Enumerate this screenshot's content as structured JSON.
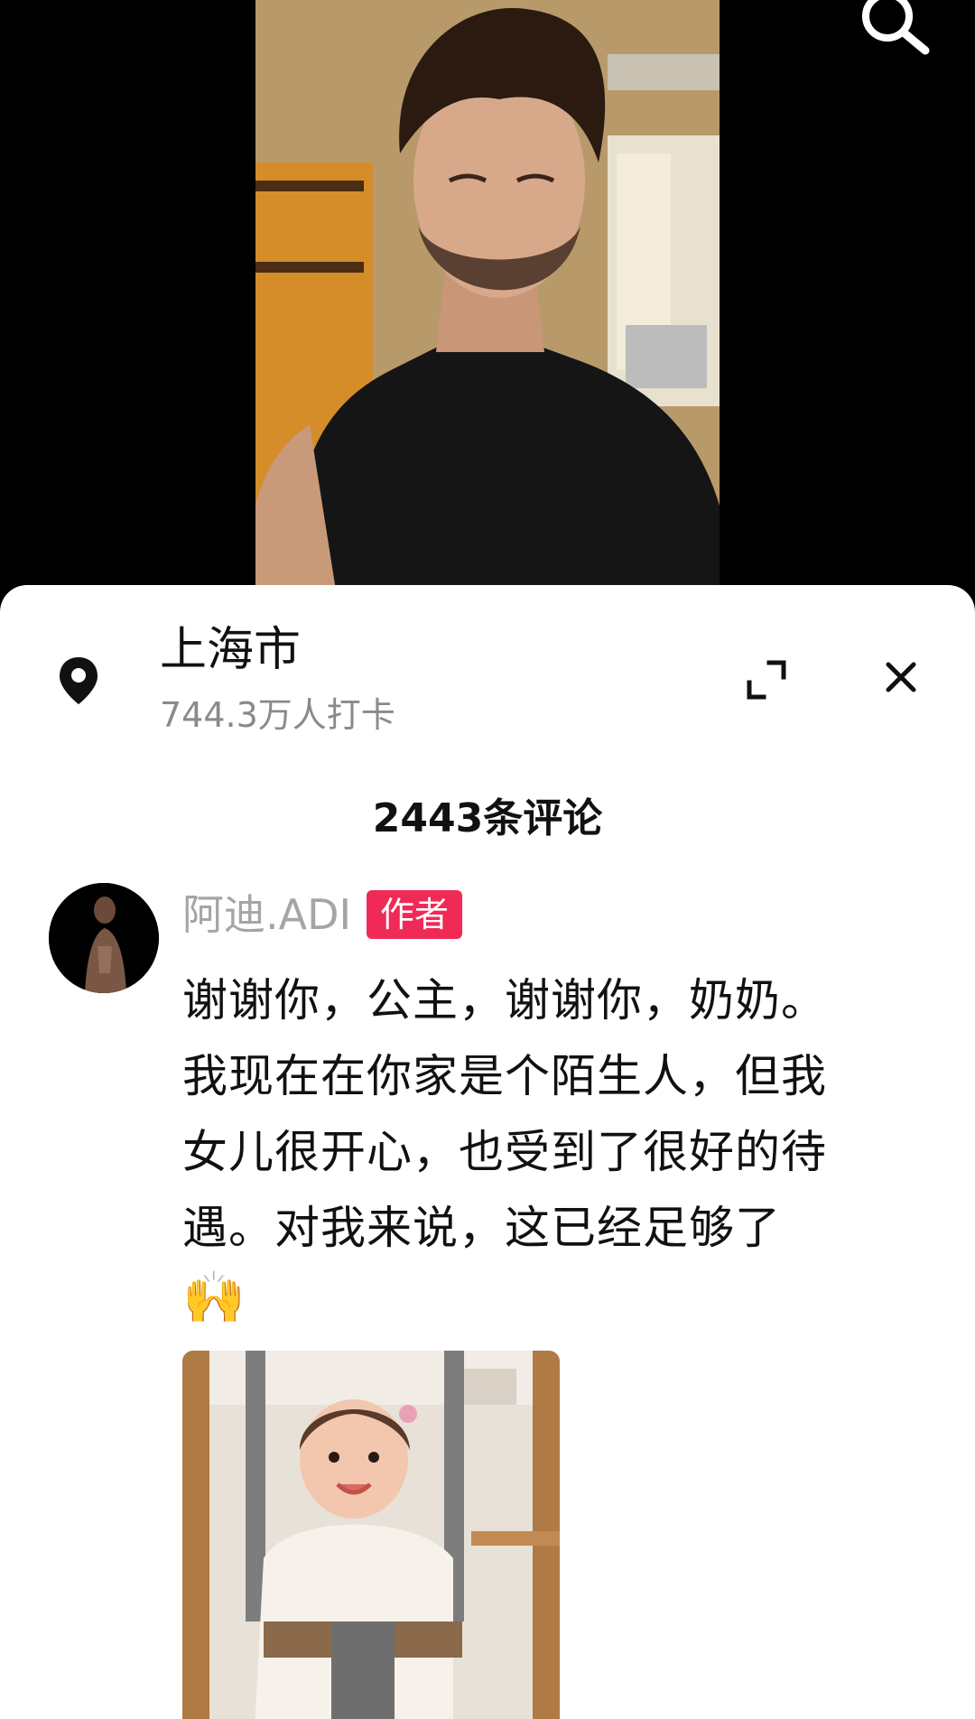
{
  "location": {
    "name": "上海市",
    "checkins": "744.3万人打卡"
  },
  "comments_header": {
    "title": "2443条评论"
  },
  "comment": {
    "username": "阿迪.ADI",
    "badge": "作者",
    "lines": [
      "谢谢你，公主，谢谢你，奶奶。",
      "我现在在你家是个陌生人，但我",
      "女儿很开心，也受到了很好的待",
      "遇。对我来说，这已经足够了"
    ],
    "emoji": "🙌"
  },
  "icons": {
    "search": "search-icon",
    "location": "location-pin-icon",
    "expand": "expand-icon",
    "close": "close-icon"
  },
  "colors": {
    "author_badge": "#f02a57",
    "sheet_background": "#ffffff",
    "video_background": "#000000"
  }
}
